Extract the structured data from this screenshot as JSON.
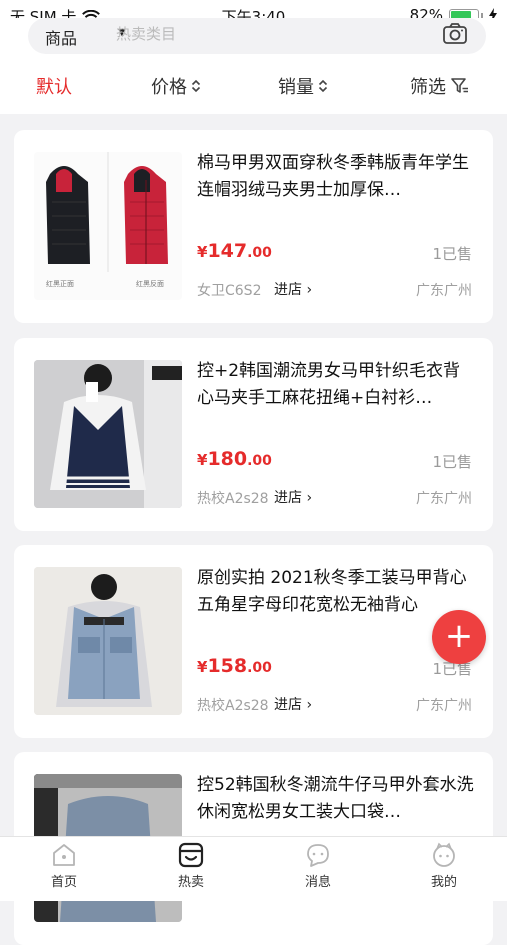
{
  "status_bar": {
    "carrier": "无 SIM 卡",
    "time": "下午3:40",
    "battery_percent": "82%",
    "battery_level": 0.82
  },
  "search": {
    "category": "商品",
    "placeholder": "热卖类目"
  },
  "sort_bar": {
    "default": "默认",
    "price": "价格",
    "sales": "销量",
    "filter": "筛选"
  },
  "products": [
    {
      "title": "棉马甲男双面穿秋冬季韩版青年学生连帽羽绒马夹男士加厚保…",
      "price_int": "147",
      "price_dec": ".00",
      "sold": "1已售",
      "shop": "女卫C6S2",
      "enter": "进店",
      "region": "广东广州",
      "thumb_caption_left": "红黑正面",
      "thumb_caption_right": "红黑反面"
    },
    {
      "title": "控+2韩国潮流男女马甲针织毛衣背心马夹手工麻花扭绳+白衬衫…",
      "price_int": "180",
      "price_dec": ".00",
      "sold": "1已售",
      "shop": "热校A2s28",
      "enter": "进店",
      "region": "广东广州"
    },
    {
      "title": "原创实拍 2021秋冬季工装马甲背心五角星字母印花宽松无袖背心",
      "price_int": "158",
      "price_dec": ".00",
      "sold": "1已售",
      "shop": "热校A2s28",
      "enter": "进店",
      "region": "广东广州"
    },
    {
      "title": "控52韩国秋冬潮流牛仔马甲外套水洗休闲宽松男女工装大口袋…",
      "price_int": "",
      "price_dec": "",
      "sold": "",
      "shop": "",
      "enter": "",
      "region": ""
    }
  ],
  "currency_symbol": "¥",
  "fab_label": "+",
  "tab_bar": {
    "home": "首页",
    "hot": "热卖",
    "messages": "消息",
    "mine": "我的"
  },
  "colors": {
    "accent": "#e52b2b",
    "fab": "#ee4040",
    "background": "#f2f2f4"
  }
}
